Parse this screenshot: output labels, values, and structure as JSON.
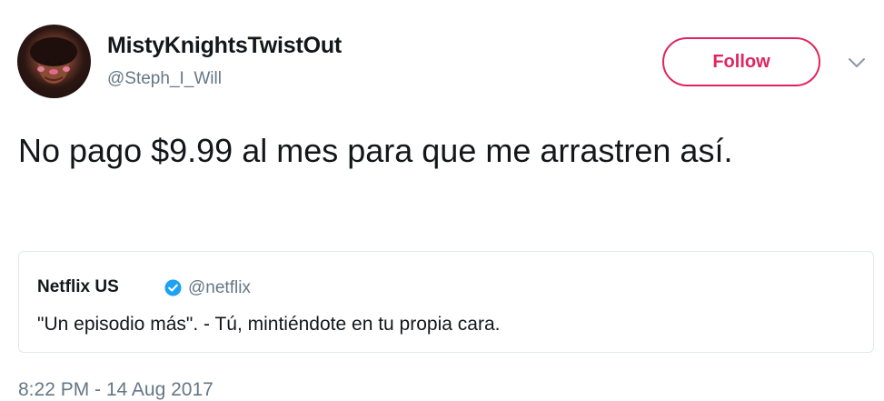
{
  "tweet": {
    "display_name": "MistyKnightsTwistOut",
    "handle": "@Steph_I_Will",
    "follow_label": "Follow",
    "text": "No pago $9.99 al mes para que me arrastren así.",
    "timestamp": "8:22 PM - 14 Aug 2017"
  },
  "quoted_tweet": {
    "author": "Netflix US",
    "verified": true,
    "handle": "@netflix",
    "text": "\"Un episodio más\". - Tú, mintiéndote en tu propia cara."
  },
  "icons": {
    "verified": "verified-badge-icon",
    "menu": "chevron-down-icon"
  },
  "colors": {
    "follow_accent": "#e0245e",
    "verified_blue": "#1da1f2",
    "secondary_text": "#657786",
    "primary_text": "#14171a",
    "card_border": "#e1e8ed"
  }
}
